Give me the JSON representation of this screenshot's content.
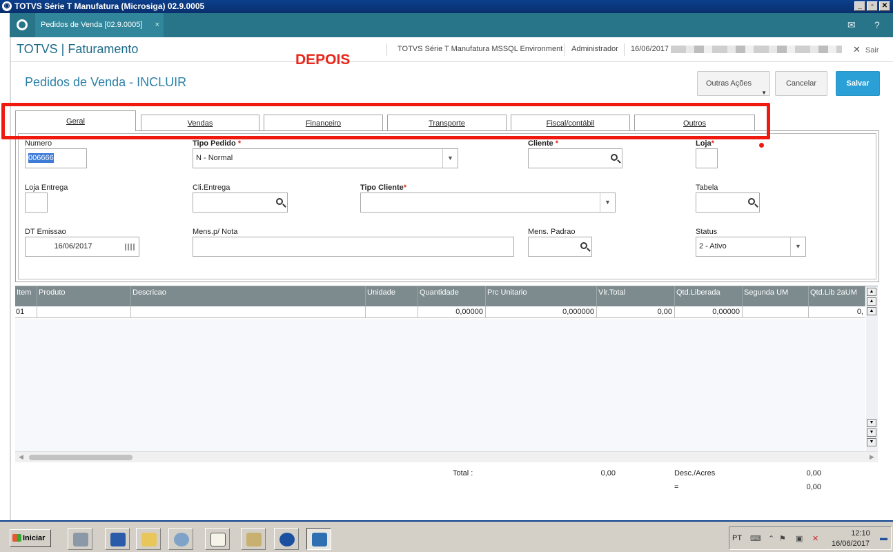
{
  "window": {
    "title": "TOTVS Série T Manufatura (Microsiga) 02.9.0005"
  },
  "tabstrip": {
    "tab_label": "Pedidos de Venda [02.9.0005]",
    "close": "×"
  },
  "header": {
    "brand": "TOTVS | Faturamento",
    "environment": "TOTVS Série T Manufatura MSSQL Environment",
    "user": "Administrador",
    "date": "16/06/2017",
    "logout": "Sair"
  },
  "annotation": {
    "text": "DEPOIS"
  },
  "page": {
    "title": "Pedidos de Venda - INCLUIR"
  },
  "actions": {
    "outras": "Outras Ações",
    "cancelar": "Cancelar",
    "salvar": "Salvar"
  },
  "tabs": [
    {
      "label": "Geral"
    },
    {
      "label": "Vendas"
    },
    {
      "label": "Financeiro"
    },
    {
      "label": "Transporte"
    },
    {
      "label": "Fiscal/contábil"
    },
    {
      "label": "Outros"
    }
  ],
  "form": {
    "numero_label": "Numero",
    "numero_value": "006666",
    "tipo_pedido_label": "Tipo Pedido",
    "tipo_pedido_value": "N - Normal",
    "cliente_label": "Cliente",
    "loja_label": "Loja",
    "loja_entrega_label": "Loja Entrega",
    "cli_entrega_label": "Cli.Entrega",
    "tipo_cliente_label": "Tipo Cliente",
    "tabela_label": "Tabela",
    "dt_emissao_label": "DT Emissao",
    "dt_emissao_value": "16/06/2017",
    "mens_nota_label": "Mens.p/ Nota",
    "mens_padrao_label": "Mens. Padrao",
    "status_label": "Status",
    "status_value": "2 - Ativo",
    "required_mark": "*"
  },
  "grid": {
    "columns": [
      "Item",
      "Produto",
      "Descricao",
      "Unidade",
      "Quantidade",
      "Prc Unitario",
      "Vlr.Total",
      "Qtd.Liberada",
      "Segunda UM",
      "Qtd.Lib 2aUM"
    ],
    "rows": [
      [
        "01",
        "",
        "",
        "",
        "0,00000",
        "0,000000",
        "0,00",
        "0,00000",
        "",
        "0,"
      ]
    ]
  },
  "totals": {
    "total_label": "Total :",
    "total_value": "0,00",
    "desc_label": "Desc./Acres",
    "desc_value": "0,00",
    "eq_label": "=",
    "eq_value": "0,00"
  },
  "taskbar": {
    "start": "Iniciar",
    "lang": "PT",
    "time": "12:10",
    "date": "16/06/2017"
  },
  "colors": {
    "accent": "#28758a",
    "primary_button": "#2aa0d6",
    "highlight_box": "#f0190f",
    "grid_header": "#7d8b8e"
  }
}
